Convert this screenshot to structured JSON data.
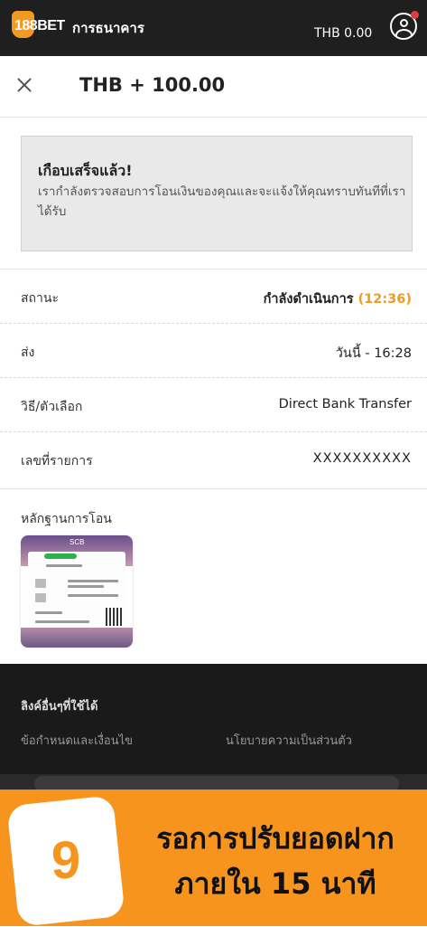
{
  "topbar": {
    "logo_text": "188BET",
    "title": "การธนาคาร",
    "balance": "THB 0.00"
  },
  "header": {
    "amount": "THB + 100.00"
  },
  "notice": {
    "title": "เกือบเสร็จแล้ว!",
    "message": "เรากำลังตรวจสอบการโอนเงินของคุณและจะแจ้งให้คุณทราบทันทีที่เราได้รับ"
  },
  "details": {
    "status_label": "สถานะ",
    "status_value": "กำลังดำเนินการ",
    "status_timer": "(12:36)",
    "sent_label": "ส่ง",
    "sent_value": "วันนี้ - 16:28",
    "method_label": "วิธี/ตัวเลือก",
    "method_value": "Direct Bank Transfer",
    "ref_label": "เลขที่รายการ",
    "ref_value": "XXXXXXXXXX"
  },
  "proof": {
    "label": "หลักฐานการโอน",
    "thumb_brand": "SCB"
  },
  "footer": {
    "title": "ลิงค์อื่นๆที่ใช้ได้",
    "links": [
      "ข้อกำหนดและเงื่อนไข",
      "นโยบายความเป็นส่วนตัว"
    ]
  },
  "banner": {
    "step": "9",
    "line1": "รอการปรับยอดฝาก",
    "line2": "ภายใน 15 นาที"
  },
  "colors": {
    "accent": "#f7941d",
    "topbar": "#1f1f1f",
    "notice_bg": "#e9e9e9"
  }
}
